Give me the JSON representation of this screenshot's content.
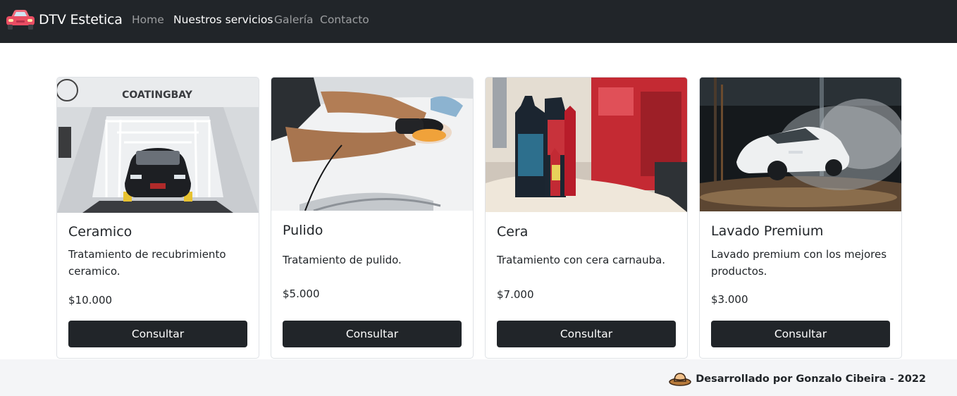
{
  "navbar": {
    "brand": "DTV Estetica",
    "brand_icon": "car-icon",
    "links": [
      "Home",
      "Nuestros servicios",
      "Galería",
      "Contacto"
    ],
    "active_link": "Nuestros servicios"
  },
  "cards": [
    {
      "title": "Ceramico",
      "text": "Tratamiento de recubrimiento ceramico.",
      "price": "$10.000",
      "button": "Consultar",
      "image_sign": "COATINGBAY"
    },
    {
      "title": "Pulido",
      "text": "Tratamiento de pulido.",
      "price": "$5.000",
      "button": "Consultar"
    },
    {
      "title": "Cera",
      "text": "Tratamiento con cera carnauba.",
      "price": "$7.000",
      "button": "Consultar"
    },
    {
      "title": "Lavado Premium",
      "text": "Lavado premium con los mejores productos.",
      "price": "$3.000",
      "button": "Consultar"
    }
  ],
  "footer": {
    "text": "Desarrollado por Gonzalo Cibeira - 2022",
    "icon": "hat-icon"
  },
  "colors": {
    "navbar_bg": "#212529",
    "button_bg": "#212529",
    "nav_muted": "rgba(255,255,255,0.55)"
  }
}
